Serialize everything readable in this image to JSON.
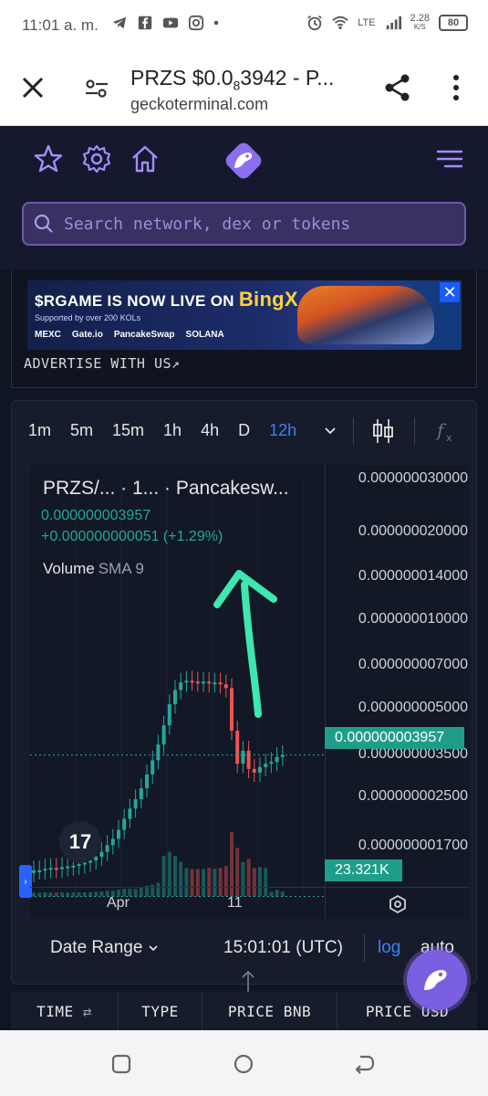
{
  "status_bar": {
    "time": "11:01 a. m.",
    "network_speed": "2.28",
    "network_unit": "K/S",
    "network_type": "LTE",
    "battery": "80"
  },
  "browser": {
    "title_prefix": "PRZS $0.0",
    "title_sub": "8",
    "title_suffix": "3942 - P...",
    "url": "geckoterminal.com"
  },
  "search": {
    "placeholder": "Search network, dex or tokens"
  },
  "ad": {
    "headline_a": "$RGAME IS NOW LIVE ON ",
    "headline_b": "BingX",
    "sub": "Supported by over 200 KOLs",
    "partners": [
      "MEXC",
      "Gate.io",
      "PancakeSwap",
      "SOLANA"
    ],
    "close": "✕",
    "link": "ADVERTISE WITH US↗"
  },
  "chart_toolbar": {
    "timeframes": [
      "1m",
      "5m",
      "15m",
      "1h",
      "4h",
      "D",
      "12h"
    ],
    "active_timeframe": "12h"
  },
  "chart_legend": {
    "pair": "PRZS/... · 1... · Pancakesw...",
    "price": "0.000000003957",
    "change": "+0.000000000051 (+1.29%)",
    "volume_label": "Volume",
    "sma_label": "SMA 9"
  },
  "chart_data": {
    "type": "candlestick",
    "title": "",
    "price_axis_ticks": [
      "0.000000030000",
      "0.000000020000",
      "0.000000014000",
      "0.000000010000",
      "0.000000007000",
      "0.000000005000",
      "0.000000003500",
      "0.000000002500",
      "0.000000001700"
    ],
    "x_axis_ticks": [
      "Apr",
      "11"
    ],
    "last_price": "0.000000003957",
    "last_volume": "23.321K",
    "scale": "log",
    "up_color": "#26a69a",
    "down_color": "#ef5350",
    "series": [
      {
        "name": "",
        "values": [
          1.6,
          1.6,
          1.62,
          1.63,
          1.62,
          1.64,
          1.65,
          1.66,
          1.68,
          1.7,
          1.73,
          1.78,
          1.85,
          1.95,
          2.05,
          2.2,
          2.4,
          2.6,
          2.8,
          3.05,
          3.4,
          3.8,
          4.3,
          5.0,
          5.9,
          6.6,
          7.0,
          7.1,
          7.05,
          7.0,
          7.05,
          6.95,
          7.0,
          6.9,
          6.7,
          4.8,
          3.7,
          4.1,
          3.55,
          3.45,
          3.6,
          3.7,
          3.75,
          3.9,
          3.96
        ]
      }
    ]
  },
  "chart_footer": {
    "date_range": "Date Range",
    "time": "15:01:01 (UTC)",
    "log": "log",
    "auto": "auto"
  },
  "table_header": {
    "columns": [
      "TIME",
      "TYPE",
      "PRICE BNB",
      "PRICE USD"
    ]
  },
  "colors": {
    "accent": "#3b82f6",
    "brand": "#7a5fe0",
    "up": "#26a69a",
    "down": "#ef5350",
    "annotation": "#3ee6b0"
  }
}
